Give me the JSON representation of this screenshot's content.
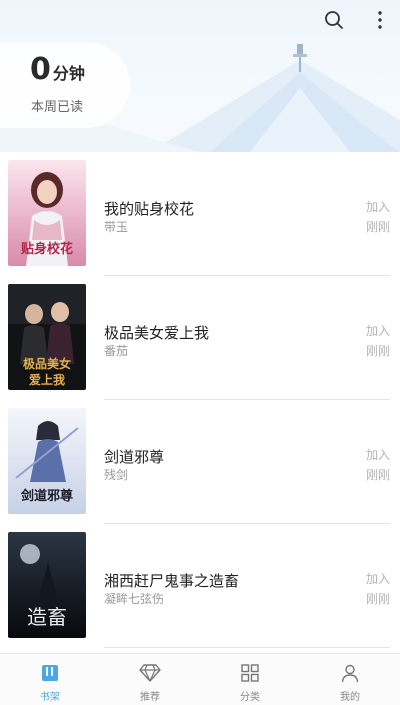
{
  "header": {
    "minutes_value": "0",
    "minutes_unit": "分钟",
    "minutes_label": "本周已读",
    "search_icon": "search-icon",
    "more_icon": "more-vertical-icon"
  },
  "books": [
    {
      "title": "我的贴身校花",
      "author": "带玉",
      "added_label": "加入",
      "time_label": "刚刚",
      "cover_text": "贴身校花",
      "cover_colors": [
        "#f7d6e2",
        "#d98aa9",
        "#b3264d"
      ]
    },
    {
      "title": "极品美女爱上我",
      "author": "番茄",
      "added_label": "加入",
      "time_label": "刚刚",
      "cover_text": "极品美女爱上我",
      "cover_colors": [
        "#2a2a2a",
        "#0e0e10",
        "#d9a23a"
      ]
    },
    {
      "title": "剑道邪尊",
      "author": "残剑",
      "added_label": "加入",
      "time_label": "刚刚",
      "cover_text": "剑道邪尊",
      "cover_colors": [
        "#eef1f8",
        "#9fb0d4",
        "#1c1c2a"
      ]
    },
    {
      "title": "湘西赶尸鬼事之造畜",
      "author": "凝眸七弦伤",
      "added_label": "加入",
      "time_label": "刚刚",
      "cover_text": "造畜",
      "cover_colors": [
        "#1a2330",
        "#0a0f16",
        "#e8e8ee"
      ]
    }
  ],
  "nav": {
    "items": [
      {
        "label": "书架",
        "icon": "bookshelf-icon",
        "active": true
      },
      {
        "label": "推荐",
        "icon": "diamond-icon",
        "active": false
      },
      {
        "label": "分类",
        "icon": "grid-icon",
        "active": false
      },
      {
        "label": "我的",
        "icon": "person-icon",
        "active": false
      }
    ],
    "active_color": "#4aa8e8"
  }
}
